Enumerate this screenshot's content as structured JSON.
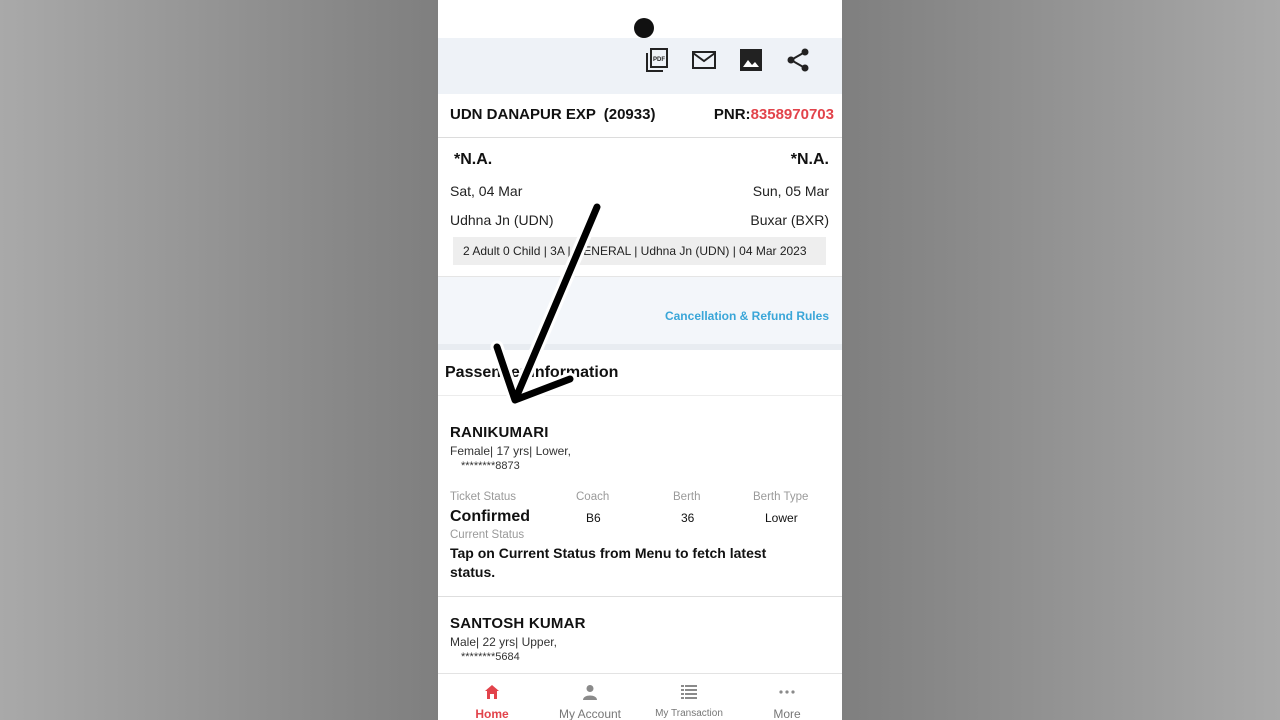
{
  "toolbar": {
    "icons": [
      "pdf-icon",
      "mail-icon",
      "image-icon",
      "share-icon"
    ],
    "pdf_text": "PDF"
  },
  "train": {
    "name": "UDN DANAPUR EXP",
    "number": "(20933)",
    "pnr_label": "PNR:",
    "pnr_value": "8358970703"
  },
  "journey": {
    "departure_time": "*N.A.",
    "arrival_time": "*N.A.",
    "departure_date": "Sat, 04 Mar",
    "arrival_date": "Sun, 05 Mar",
    "from_station": "Udhna Jn (UDN)",
    "to_station": "Buxar (BXR)",
    "summary": "2 Adult 0 Child  | 3A | GENERAL | Udhna Jn (UDN) | 04 Mar 2023"
  },
  "rules_link": "Cancellation & Refund Rules",
  "passenger_section_title": "Passenger Information",
  "passengers": [
    {
      "name": "RANIKUMARI",
      "meta": "Female| 17 yrs| Lower,",
      "id": "********8873",
      "ticket_status_label": "Ticket Status",
      "ticket_status": "Confirmed",
      "coach_label": "Coach",
      "coach": "B6",
      "berth_label": "Berth",
      "berth": "36",
      "berth_type_label": "Berth Type",
      "berth_type": "Lower",
      "current_status_label": "Current Status",
      "current_status": "Tap on Current Status from Menu to fetch latest status."
    },
    {
      "name": "SANTOSH KUMAR",
      "meta": "Male| 22 yrs| Upper,",
      "id": "********5684"
    }
  ],
  "bottom_nav": [
    {
      "label": "Home",
      "icon": "home-icon",
      "active": true
    },
    {
      "label": "My Account",
      "icon": "person-icon",
      "active": false
    },
    {
      "label": "My Transaction",
      "icon": "list-icon",
      "active": false
    },
    {
      "label": "More",
      "icon": "more-dots-icon",
      "active": false
    }
  ],
  "colors": {
    "accent_red": "#e2434b",
    "link_blue": "#3aa6d8",
    "toolbar_bg": "#eef2f7"
  }
}
